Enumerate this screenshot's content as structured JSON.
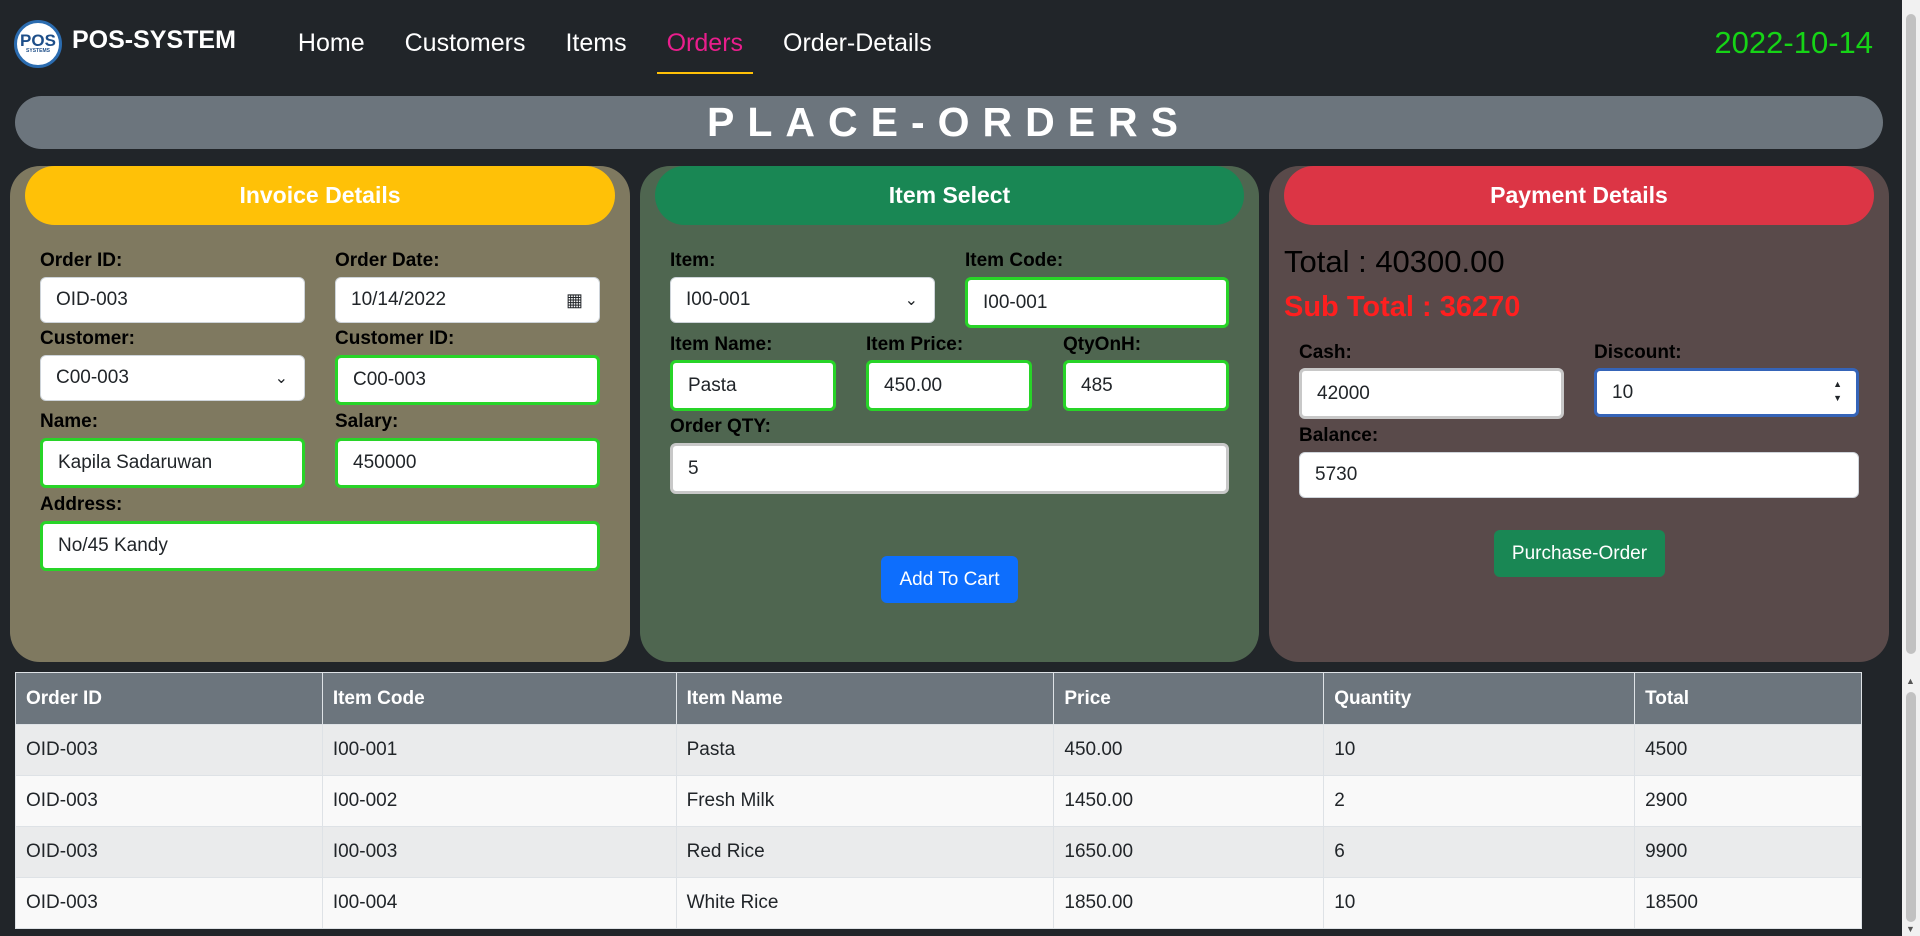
{
  "brand": {
    "logo_top": "POS",
    "logo_bottom": "SYSTEMS",
    "name": "POS-SYSTEM"
  },
  "nav": [
    "Home",
    "Customers",
    "Items",
    "Orders",
    "Order-Details"
  ],
  "nav_active": "Orders",
  "date": "2022-10-14",
  "page_title": "PLACE-ORDERS",
  "invoice": {
    "heading": "Invoice Details",
    "order_id_label": "Order ID:",
    "order_id": "OID-003",
    "order_date_label": "Order Date:",
    "order_date": "10/14/2022",
    "customer_label": "Customer:",
    "customer": "C00-003",
    "customer_id_label": "Customer ID:",
    "customer_id": "C00-003",
    "name_label": "Name:",
    "name": "Kapila Sadaruwan",
    "salary_label": "Salary:",
    "salary": "450000",
    "address_label": "Address:",
    "address": "No/45 Kandy"
  },
  "item_select": {
    "heading": "Item Select",
    "item_label": "Item:",
    "item": "I00-001",
    "item_code_label": "Item Code:",
    "item_code": "I00-001",
    "item_name_label": "Item Name:",
    "item_name": "Pasta",
    "item_price_label": "Item Price:",
    "item_price": "450.00",
    "qty_on_hand_label": "QtyOnH:",
    "qty_on_hand": "485",
    "order_qty_label": "Order QTY:",
    "order_qty": "5",
    "add_button": "Add To Cart"
  },
  "payment": {
    "heading": "Payment Details",
    "total": "Total : 40300.00",
    "sub_total": "Sub Total : 36270",
    "cash_label": "Cash:",
    "cash": "42000",
    "discount_label": "Discount:",
    "discount": "10",
    "balance_label": "Balance:",
    "balance": "5730",
    "purchase_button": "Purchase-Order"
  },
  "table": {
    "headers": [
      "Order ID",
      "Item Code",
      "Item Name",
      "Price",
      "Quantity",
      "Total"
    ],
    "rows": [
      [
        "OID-003",
        "I00-001",
        "Pasta",
        "450.00",
        "10",
        "4500"
      ],
      [
        "OID-003",
        "I00-002",
        "Fresh Milk",
        "1450.00",
        "2",
        "2900"
      ],
      [
        "OID-003",
        "I00-003",
        "Red Rice",
        "1650.00",
        "6",
        "9900"
      ],
      [
        "OID-003",
        "I00-004",
        "White Rice",
        "1850.00",
        "10",
        "18500"
      ]
    ]
  },
  "colors": {
    "background": "#212529",
    "active_nav": "#e91e8c",
    "date": "#16d416",
    "invoice_head": "#ffc107",
    "item_head": "#198754",
    "payment_head": "#dc3545",
    "valid_border": "#28d428"
  }
}
